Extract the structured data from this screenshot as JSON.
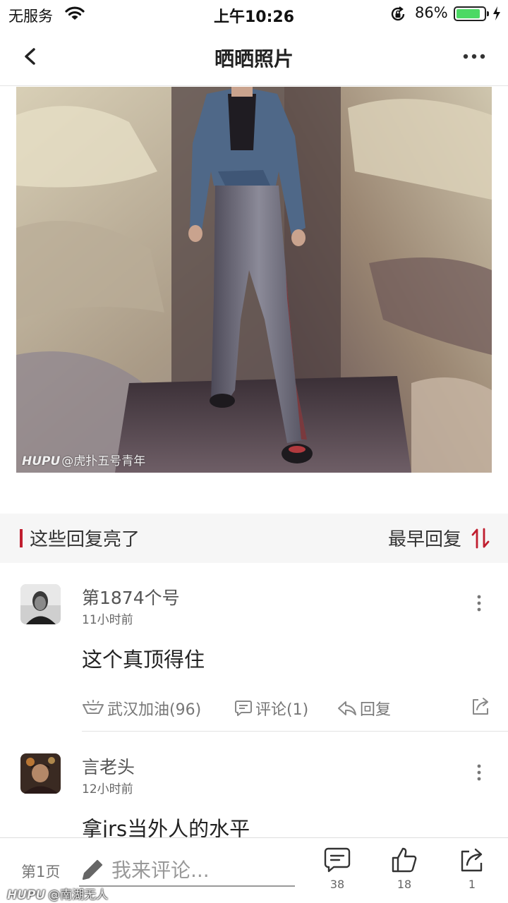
{
  "status_bar": {
    "carrier": "无服务",
    "time": "上午10:26",
    "battery_percent": "86%",
    "battery_level": 0.86
  },
  "nav": {
    "title": "晒晒照片"
  },
  "photo": {
    "watermark_brand": "HUPU",
    "watermark_user": "@虎扑五号青年"
  },
  "section": {
    "title": "这些回复亮了",
    "sort_label": "最早回复"
  },
  "replies": [
    {
      "username": "第1874个号",
      "time": "11小时前",
      "content": "这个真顶得住",
      "light_label": "武汉加油(96)",
      "comment_label": "评论(1)",
      "reply_label": "回复"
    },
    {
      "username": "言老头",
      "time": "12小时前",
      "content": "拿jrs当外人的水平"
    }
  ],
  "bottom_bar": {
    "page_label": "第1页",
    "comment_placeholder": "我来评论...",
    "comment_count": "38",
    "like_count": "18",
    "share_count": "1"
  },
  "bottom_watermark": {
    "brand": "HUPU",
    "user": "@南湖无人"
  },
  "colors": {
    "accent_red": "#c01e2f",
    "battery_green": "#4cd964"
  }
}
